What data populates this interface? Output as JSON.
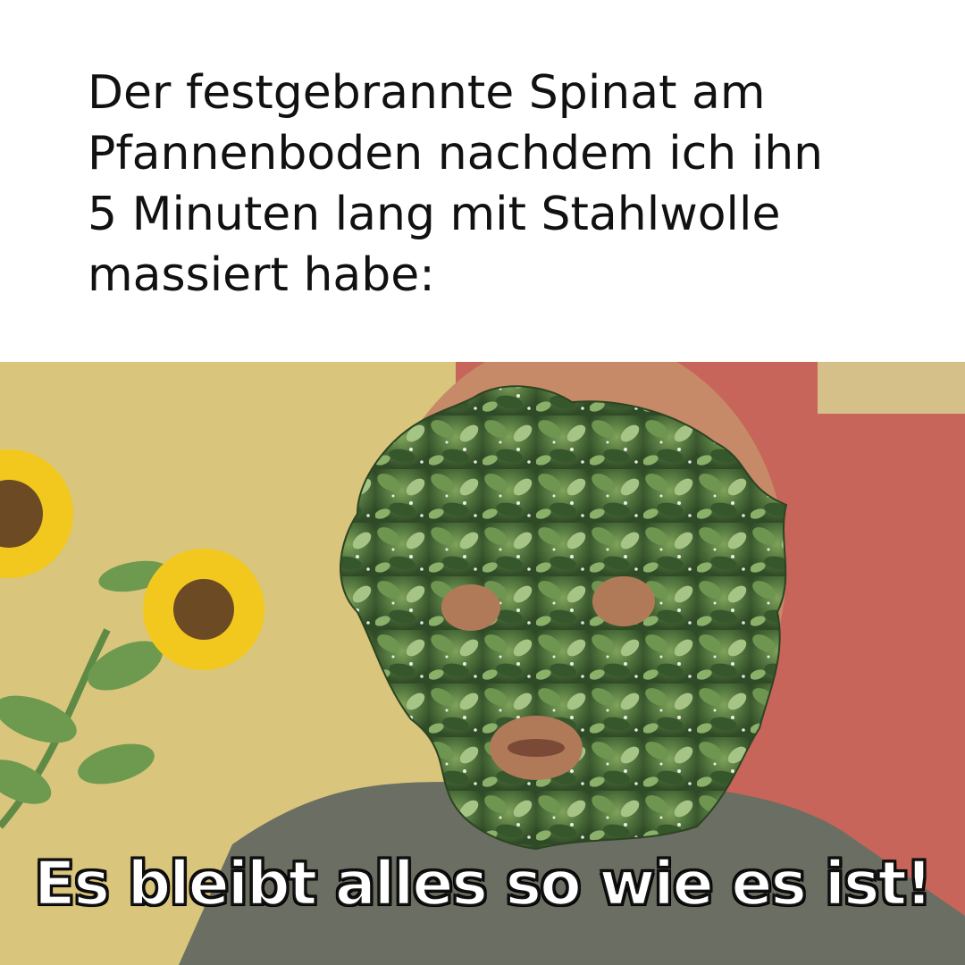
{
  "meme": {
    "top_caption": "Der festgebrannte Spinat am\nPfannenboden nachdem ich ihn\n5 Minuten lang mit Stahlwolle\nmassiert habe:",
    "bottom_subtitle": "Es bleibt alles so wie es ist!"
  },
  "colors": {
    "wall_yellow": "#d9c57c",
    "wall_red": "#c8655a",
    "spinach_dark": "#3f5e32",
    "spinach_light": "#8fb06a",
    "shirt": "#6b6e62",
    "skin": "#c68a68",
    "sunflower_petal": "#f2c81e",
    "sunflower_center": "#6b4a24"
  }
}
